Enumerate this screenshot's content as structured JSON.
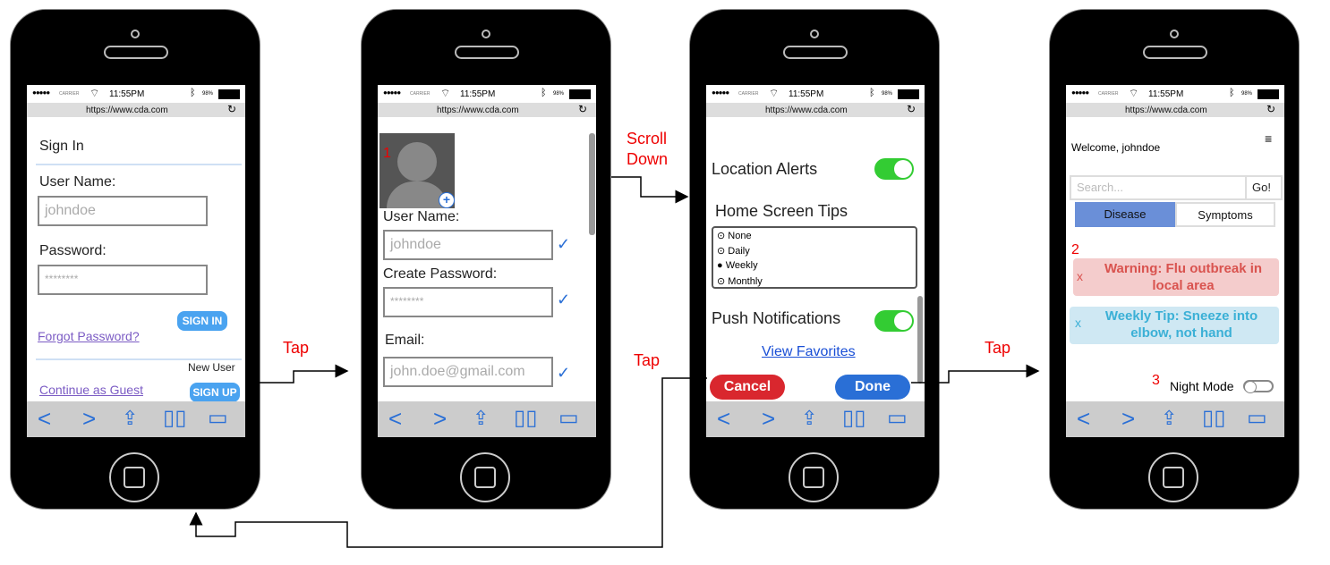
{
  "status": {
    "carrier": "CARRIER",
    "time": "11:55PM",
    "battery": "98%",
    "url": "https://www.cda.com"
  },
  "screen1": {
    "title": "Sign In",
    "username_label": "User Name:",
    "username_value": "johndoe",
    "password_label": "Password:",
    "password_value": "********",
    "forgot": "Forgot Password?",
    "signin": "SIGN IN",
    "new_user": "New User",
    "guest": "Continue as Guest",
    "signup": "SIGN UP"
  },
  "screen2": {
    "marker": "1",
    "username_label": "User Name:",
    "username_value": "johndoe",
    "password_label": "Create Password:",
    "password_value": "********",
    "email_label": "Email:",
    "email_value": "john.doe@gmail.com"
  },
  "screen3": {
    "location_alerts": "Location Alerts",
    "tips_label": "Home Screen Tips",
    "options": [
      "None",
      "Daily",
      "Weekly",
      "Monthly"
    ],
    "selected": "Weekly",
    "push": "Push Notifications",
    "favorites": "View Favorites",
    "cancel": "Cancel",
    "done": "Done"
  },
  "screen4": {
    "welcome": "Welcome, johndoe",
    "search_placeholder": "Search...",
    "go": "Go!",
    "tab_disease": "Disease",
    "tab_symptoms": "Symptoms",
    "marker2": "2",
    "warning_x": "x",
    "warning": "Warning: Flu outbreak in local area",
    "tip_x": "x",
    "tip": "Weekly Tip: Sneeze into elbow, not hand",
    "marker3": "3",
    "night_mode": "Night Mode"
  },
  "flow": {
    "tap1": "Tap",
    "scroll1": "Scroll",
    "scroll2": "Down",
    "tap2": "Tap",
    "tap3": "Tap"
  },
  "colors": {
    "accent": "#2a6fd6",
    "warning_bg": "#f4cccc",
    "warning_text": "#d9534f",
    "tip_bg": "#cfe8f3",
    "tip_text": "#3bb0d6",
    "tab_active": "#6a8fd8",
    "cancel": "#d9272e",
    "done": "#2a6fd6"
  }
}
